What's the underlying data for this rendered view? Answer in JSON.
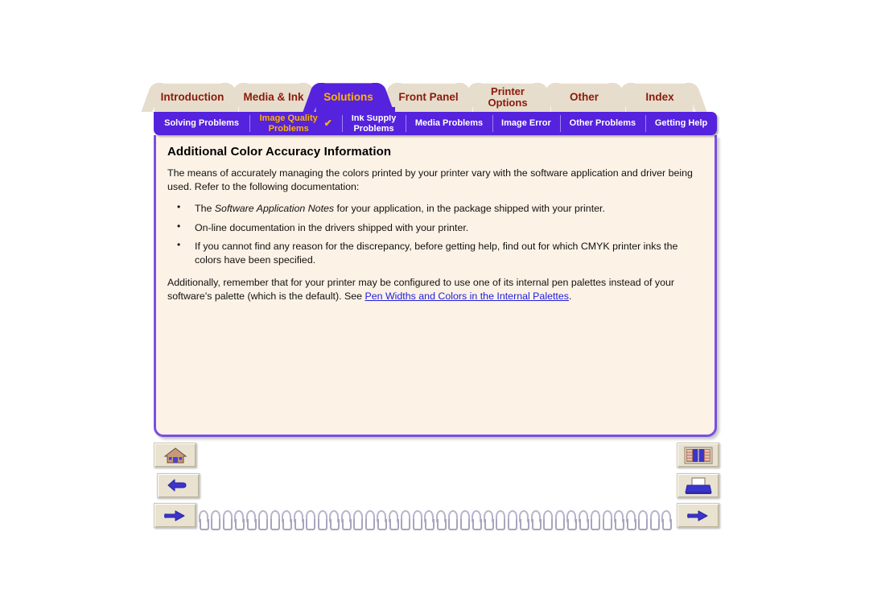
{
  "main_tabs": [
    {
      "label": "Introduction",
      "active": false
    },
    {
      "label": "Media & Ink",
      "active": false
    },
    {
      "label": "Solutions",
      "active": true
    },
    {
      "label": "Front Panel",
      "active": false
    },
    {
      "label": "Printer Options",
      "line1": "Printer",
      "line2": "Options",
      "active": false
    },
    {
      "label": "Other",
      "active": false
    },
    {
      "label": "Index",
      "active": false
    }
  ],
  "sub_tabs": [
    {
      "line1": "Solving Problems",
      "line2": "",
      "current": false,
      "check": ""
    },
    {
      "line1": "Image Quality",
      "line2": "Problems",
      "current": true,
      "check": "✔"
    },
    {
      "line1": "Ink Supply",
      "line2": "Problems",
      "current": false,
      "check": ""
    },
    {
      "line1": "Media Problems",
      "line2": "",
      "current": false,
      "check": ""
    },
    {
      "line1": "Image Error",
      "line2": "",
      "current": false,
      "check": ""
    },
    {
      "line1": "Other Problems",
      "line2": "",
      "current": false,
      "check": ""
    },
    {
      "line1": "Getting Help",
      "line2": "",
      "current": false,
      "check": ""
    }
  ],
  "document": {
    "title": "Additional Color Accuracy Information",
    "intro": "The means of accurately managing the colors printed by your printer vary with the software application and driver being used. Refer to the following documentation:",
    "bullets": [
      {
        "pre": "The ",
        "italic": "Software Application Notes",
        "post": " for your application, in the package shipped with your printer."
      },
      {
        "pre": "On-line documentation in the drivers shipped with your printer.",
        "italic": "",
        "post": ""
      },
      {
        "pre": "If you cannot find any reason for the discrepancy, before getting help, find out for which CMYK printer inks the colors have been specified.",
        "italic": "",
        "post": ""
      }
    ],
    "closing_pre": "Additionally, remember that for your printer may be configured to use one of its internal pen palettes instead of your software's palette (which is the default). See ",
    "closing_link": "Pen Widths and Colors in the Internal Palettes",
    "closing_post": "."
  },
  "nav_buttons": {
    "home": "home-icon",
    "back": "back-arrow-icon",
    "forward_left": "pointing-hand-icon",
    "index": "index-bookshelf-icon",
    "print": "printer-icon",
    "forward_right": "pointing-hand-icon"
  },
  "colors": {
    "accent_purple": "#5522dd",
    "tab_beige": "#e6ddcc",
    "tab_text": "#8b1a0a",
    "highlight_orange": "#ffb400",
    "page_cream": "#fdf2e6",
    "link_blue": "#2020dd",
    "border_purple": "#7a4fe0"
  },
  "spiral": {
    "ring_count": 40
  }
}
